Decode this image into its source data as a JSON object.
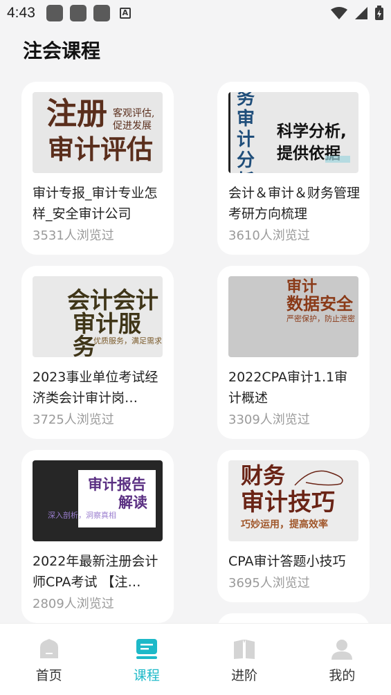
{
  "status_bar": {
    "time": "4:43"
  },
  "header": {
    "title": "注会课程"
  },
  "courses": [
    {
      "title": "审计专报_审计专业怎样_安全审计公司",
      "views": "3531人浏览过",
      "thumb": {
        "line1": "注册",
        "line2": "审计评估",
        "sub": "客观评估,\n促进发展"
      }
    },
    {
      "title": "会计＆审计＆财务管理考研方向梳理",
      "views": "3610人浏览过",
      "thumb": {
        "vertical": "务审计分析",
        "line1": "科学分析,",
        "line2": "提供依据"
      }
    },
    {
      "title": "2023事业单位考试经济类会计审计岗…",
      "views": "3725人浏览过",
      "thumb": {
        "line1": "会计会计",
        "line2": "审计服务",
        "sub": "优质服务，满足需求"
      }
    },
    {
      "title": "2022CPA审计1.1审计概述",
      "views": "3309人浏览过",
      "thumb": {
        "line1": "审计",
        "line2": "数据安全",
        "sub": "严密保护，防止泄密"
      }
    },
    {
      "title": "2022年最新注册会计师CPA考试 【注…",
      "views": "2809人浏览过",
      "thumb": {
        "line1": "审计报告",
        "line2": "解读",
        "sub": "深入剖析，洞察真相"
      }
    },
    {
      "title": "CPA审计答题小技巧",
      "views": "3695人浏览过",
      "thumb": {
        "line1": "财务",
        "line2": "审计技巧",
        "sub": "巧妙运用，提高效率"
      }
    }
  ],
  "tabs": [
    {
      "label": "首页",
      "icon": "home-icon",
      "active": false
    },
    {
      "label": "课程",
      "icon": "course-icon",
      "active": true
    },
    {
      "label": "进阶",
      "icon": "book-icon",
      "active": false
    },
    {
      "label": "我的",
      "icon": "user-icon",
      "active": false
    }
  ],
  "colors": {
    "accent": "#1db9c8",
    "background": "#f4f4f5",
    "views_text": "#9a9a9a"
  }
}
